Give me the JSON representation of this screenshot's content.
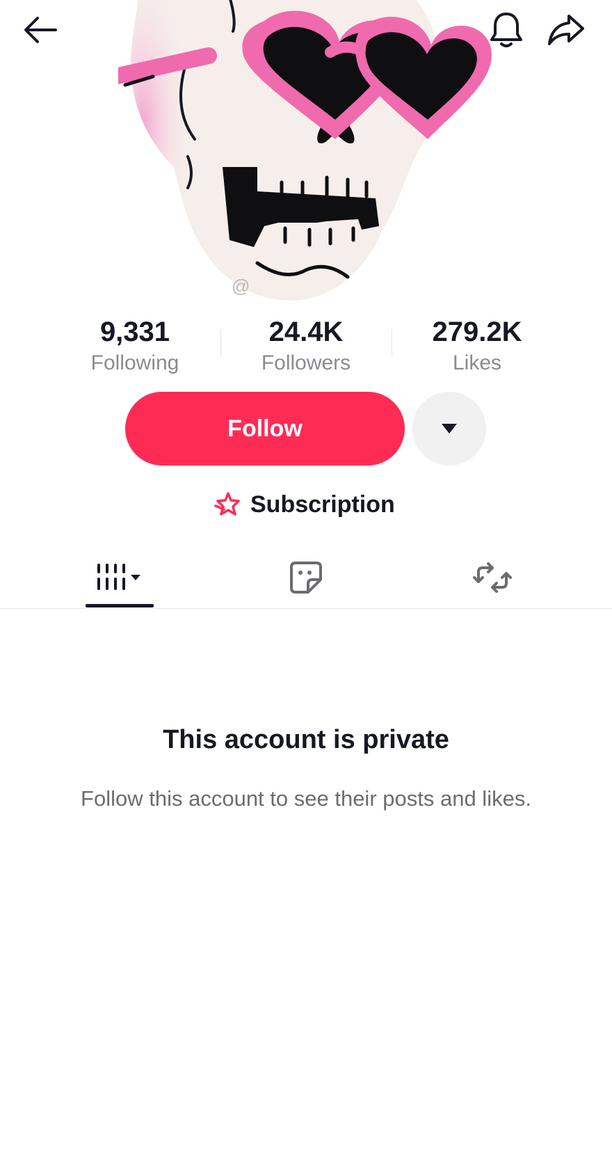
{
  "profile": {
    "handle_prefix": "@",
    "avatar_icon": "skull-with-heart-sunglasses"
  },
  "header": {
    "back_icon": "back-arrow-icon",
    "bell_icon": "bell-icon",
    "share_icon": "share-icon"
  },
  "stats": [
    {
      "value": "9,331",
      "label": "Following"
    },
    {
      "value": "24.4K",
      "label": "Followers"
    },
    {
      "value": "279.2K",
      "label": "Likes"
    }
  ],
  "actions": {
    "follow_label": "Follow",
    "more_icon": "caret-down-icon"
  },
  "subscription": {
    "label": "Subscription",
    "icon": "subscription-star-icon"
  },
  "tabs": [
    {
      "icon": "videos-grid-icon",
      "selected": true
    },
    {
      "icon": "liked-sticker-icon",
      "selected": false
    },
    {
      "icon": "repost-icon",
      "selected": false
    }
  ],
  "private_notice": {
    "title": "This account is private",
    "description": "Follow this account to see their posts and likes."
  },
  "colors": {
    "accent": "#fe2c55",
    "text_primary": "#161823",
    "text_secondary": "#8a8b91"
  }
}
